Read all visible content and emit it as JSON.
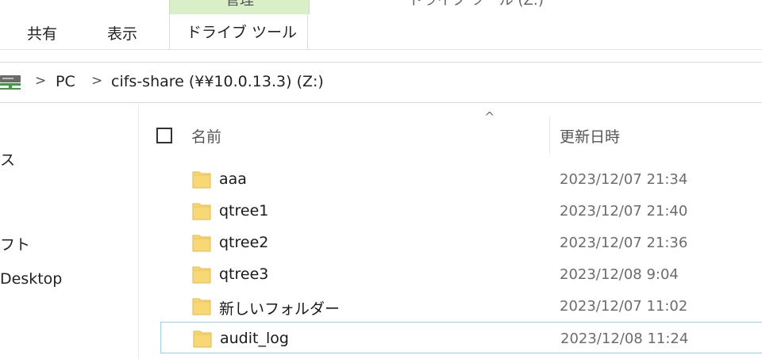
{
  "ribbon": {
    "context_group_label": "管理",
    "context_tools_title": "ドライブ ツール (Z:)",
    "tabs": {
      "share": "共有",
      "view": "表示",
      "drive_tools": "ドライブ ツール"
    }
  },
  "address": {
    "items": [
      "PC",
      "cifs-share (¥¥10.0.13.3) (Z:)"
    ],
    "separator": ">"
  },
  "nav": {
    "items": [
      "ス",
      "フト",
      "Desktop"
    ]
  },
  "list": {
    "columns": {
      "name": "名前",
      "modified": "更新日時"
    },
    "sort_caret": "^",
    "rows": [
      {
        "name": "aaa",
        "modified": "2023/12/07 21:34"
      },
      {
        "name": "qtree1",
        "modified": "2023/12/07 21:40"
      },
      {
        "name": "qtree2",
        "modified": "2023/12/07 21:36"
      },
      {
        "name": "qtree3",
        "modified": "2023/12/08 9:04"
      },
      {
        "name": "新しいフォルダー",
        "modified": "2023/12/07 11:02"
      },
      {
        "name": "audit_log",
        "modified": "2023/12/08 11:24"
      }
    ]
  },
  "colors": {
    "context_tab_green": "#d9efc7",
    "folder_yellow": "#f8d775",
    "selection_border": "#99d1ff"
  }
}
